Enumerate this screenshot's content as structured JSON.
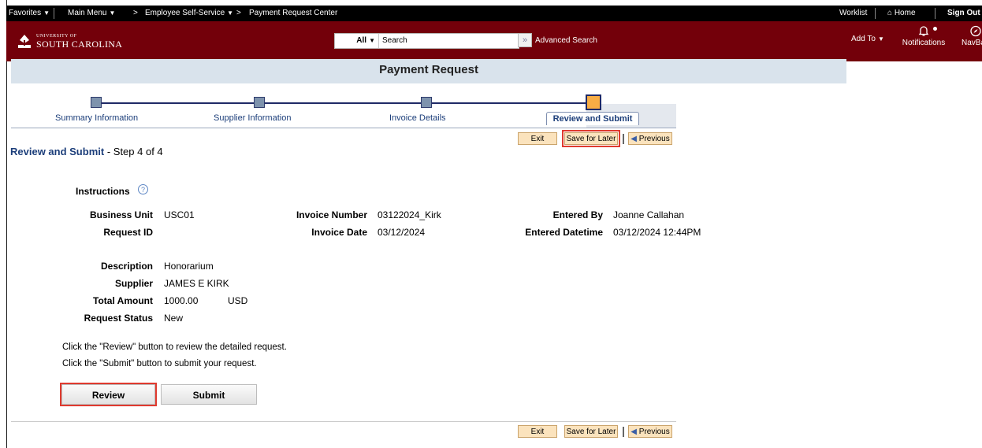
{
  "topnav": {
    "favorites": "Favorites",
    "main_menu": "Main Menu",
    "crumb_sep": ">",
    "breadcrumb_1": "Employee Self-Service",
    "breadcrumb_2": "Payment Request Center",
    "worklist": "Worklist",
    "home": "Home",
    "sign_out": "Sign Out"
  },
  "header": {
    "logo_line1": "UNIVERSITY OF",
    "logo_line2": "SOUTH CAROLINA",
    "search_scope": "All",
    "search_value": "Search",
    "advanced_search": "Advanced Search",
    "add_to": "Add To",
    "notifications": "Notifications",
    "navbar": "NavBar"
  },
  "page_title": "Payment Request",
  "steps": [
    {
      "label": "Summary Information"
    },
    {
      "label": "Supplier Information"
    },
    {
      "label": "Invoice Details"
    },
    {
      "label": "Review and Submit"
    }
  ],
  "buttons": {
    "exit": "Exit",
    "save_for_later": "Save for Later",
    "previous": "Previous",
    "review": "Review",
    "submit": "Submit"
  },
  "step_title": "Review and Submit",
  "step_count": "- Step 4 of 4",
  "instructions": "Instructions",
  "help_glyph": "?",
  "fields": {
    "business_unit_label": "Business Unit",
    "business_unit": "USC01",
    "request_id_label": "Request ID",
    "request_id": "",
    "invoice_number_label": "Invoice Number",
    "invoice_number": "03122024_Kirk",
    "invoice_date_label": "Invoice Date",
    "invoice_date": "03/12/2024",
    "entered_by_label": "Entered By",
    "entered_by": "Joanne Callahan",
    "entered_datetime_label": "Entered Datetime",
    "entered_datetime": "03/12/2024 12:44PM",
    "description_label": "Description",
    "description": "Honorarium",
    "supplier_label": "Supplier",
    "supplier": "JAMES E KIRK",
    "total_amount_label": "Total Amount",
    "total_amount": "1000.00",
    "currency": "USD",
    "request_status_label": "Request Status",
    "request_status": "New"
  },
  "notes": {
    "review_note": "Click the \"Review\" button to review the detailed request.",
    "submit_note": "Click the \"Submit\" button to submit your request."
  },
  "colors": {
    "header_maroon": "#73000a",
    "title_bar": "#d9e3ec",
    "highlight_red": "#e03a2f",
    "active_step": "#f7ad45"
  }
}
